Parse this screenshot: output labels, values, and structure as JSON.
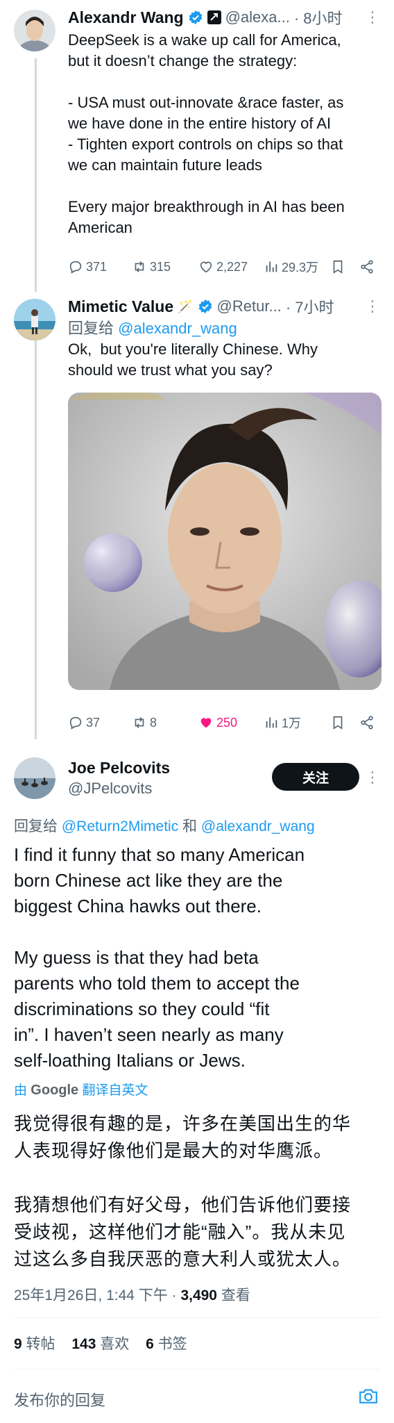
{
  "tweets": [
    {
      "name": "Alexandr Wang",
      "handle": "@alexa...",
      "time": "· 8小时",
      "text": "DeepSeek is a wake up call for America,\nbut it doesn’t change the strategy:\n\n- USA must out-innovate &race faster, as\nwe have done in the entire history of AI\n- Tighten export controls on chips so that\nwe can maintain future leads\n\nEvery major breakthrough in AI has been\nAmerican",
      "stats": {
        "replies": "371",
        "retweets": "315",
        "likes": "2,227",
        "views": "29.3万"
      }
    },
    {
      "name": "Mimetic Value",
      "name_emoji": "🪄",
      "handle": "@Retur...",
      "time": "· 7小时",
      "reply_prefix": "回复给 ",
      "reply_to": "@alexandr_wang",
      "text": "Ok,  but you're literally Chinese. Why\nshould we trust what you say?",
      "stats": {
        "replies": "37",
        "retweets": "8",
        "likes": "250",
        "views": "1万"
      },
      "like_color": "#f91880"
    }
  ],
  "main": {
    "name": "Joe Pelcovits",
    "handle": "@JPelcovits",
    "follow_label": "关注",
    "reply_prefix": "回复给 ",
    "reply_to_1": "@Return2Mimetic",
    "reply_joiner": " 和 ",
    "reply_to_2": "@alexandr_wang",
    "text": "I find it funny that so many American\nborn Chinese act like they are the\nbiggest China hawks out there.\n\nMy guess is that they had beta\nparents who told them to accept the\ndiscriminations so they could “fit\nin”. I haven’t seen nearly as many\nself-loathing Italians or Jews.",
    "translate_by": "由",
    "translate_brand": "Google",
    "translate_label": "翻译自英文",
    "translation": "我觉得很有趣的是，许多在美国出生的华\n人表现得好像他们是最大的对华鹰派。\n\n我猜想他们有好父母，他们告诉他们要接\n受歧视，这样他们才能“融入”。我从未见\n过这么多自我厌恶的意大利人或犹太人。",
    "timestamp": "25年1月26日, 1:44 下午 · ",
    "views_count": "3,490",
    "views_label": " 查看",
    "retweets_count": "9",
    "retweets_label": " 转帖",
    "likes_count": "143",
    "likes_label": " 喜欢",
    "bookmarks_count": "6",
    "bookmarks_label": " 书签"
  },
  "composer": {
    "placeholder": "发布你的回复"
  },
  "colors": {
    "accent": "#1d9bf0",
    "muted": "#536471",
    "text": "#0f1419"
  }
}
